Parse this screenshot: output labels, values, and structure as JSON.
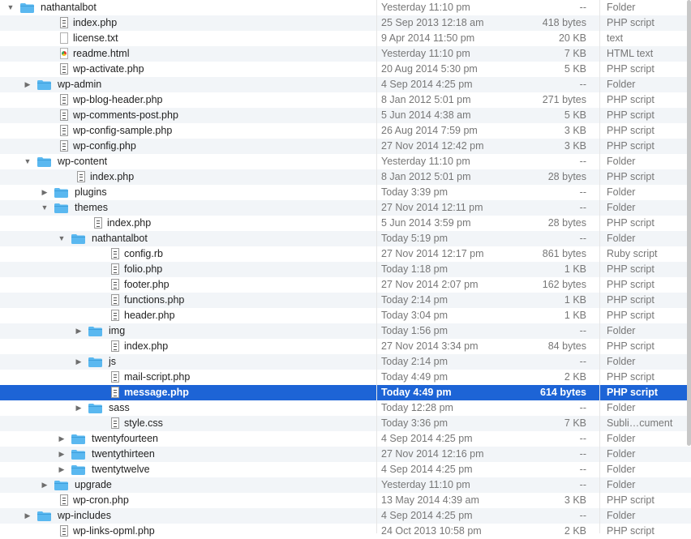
{
  "colors": {
    "selection": "#1d64d6",
    "folder": "#5ab8f0"
  },
  "rows": [
    {
      "depth": 0,
      "icon": "folder",
      "expanded": true,
      "name": "nathantalbot",
      "date": "Yesterday 11:10 pm",
      "size": "--",
      "kind": "Folder"
    },
    {
      "depth": 1,
      "icon": "doc",
      "name": "index.php",
      "date": "25 Sep 2013 12:18 am",
      "size": "418 bytes",
      "kind": "PHP script"
    },
    {
      "depth": 1,
      "icon": "txt",
      "name": "license.txt",
      "date": "9 Apr 2014 11:50 pm",
      "size": "20 KB",
      "kind": "text"
    },
    {
      "depth": 1,
      "icon": "html",
      "name": "readme.html",
      "date": "Yesterday 11:10 pm",
      "size": "7 KB",
      "kind": "HTML text"
    },
    {
      "depth": 1,
      "icon": "doc",
      "name": "wp-activate.php",
      "date": "20 Aug 2014 5:30 pm",
      "size": "5 KB",
      "kind": "PHP script"
    },
    {
      "depth": 1,
      "icon": "folder",
      "expanded": false,
      "name": "wp-admin",
      "date": "4 Sep 2014 4:25 pm",
      "size": "--",
      "kind": "Folder"
    },
    {
      "depth": 1,
      "icon": "doc",
      "name": "wp-blog-header.php",
      "date": "8 Jan 2012 5:01 pm",
      "size": "271 bytes",
      "kind": "PHP script"
    },
    {
      "depth": 1,
      "icon": "doc",
      "name": "wp-comments-post.php",
      "date": "5 Jun 2014 4:38 am",
      "size": "5 KB",
      "kind": "PHP script"
    },
    {
      "depth": 1,
      "icon": "doc",
      "name": "wp-config-sample.php",
      "date": "26 Aug 2014 7:59 pm",
      "size": "3 KB",
      "kind": "PHP script"
    },
    {
      "depth": 1,
      "icon": "doc",
      "name": "wp-config.php",
      "date": "27 Nov 2014 12:42 pm",
      "size": "3 KB",
      "kind": "PHP script"
    },
    {
      "depth": 1,
      "icon": "folder",
      "expanded": true,
      "name": "wp-content",
      "date": "Yesterday 11:10 pm",
      "size": "--",
      "kind": "Folder"
    },
    {
      "depth": 2,
      "icon": "doc",
      "name": "index.php",
      "date": "8 Jan 2012 5:01 pm",
      "size": "28 bytes",
      "kind": "PHP script"
    },
    {
      "depth": 2,
      "icon": "folder",
      "expanded": false,
      "name": "plugins",
      "date": "Today 3:39 pm",
      "size": "--",
      "kind": "Folder"
    },
    {
      "depth": 2,
      "icon": "folder",
      "expanded": true,
      "name": "themes",
      "date": "27 Nov 2014 12:11 pm",
      "size": "--",
      "kind": "Folder"
    },
    {
      "depth": 3,
      "icon": "doc",
      "name": "index.php",
      "date": "5 Jun 2014 3:59 pm",
      "size": "28 bytes",
      "kind": "PHP script"
    },
    {
      "depth": 3,
      "icon": "folder",
      "expanded": true,
      "name": "nathantalbot",
      "date": "Today 5:19 pm",
      "size": "--",
      "kind": "Folder"
    },
    {
      "depth": 4,
      "icon": "doc",
      "name": "config.rb",
      "date": "27 Nov 2014 12:17 pm",
      "size": "861 bytes",
      "kind": "Ruby script"
    },
    {
      "depth": 4,
      "icon": "doc",
      "name": "folio.php",
      "date": "Today 1:18 pm",
      "size": "1 KB",
      "kind": "PHP script"
    },
    {
      "depth": 4,
      "icon": "doc",
      "name": "footer.php",
      "date": "27 Nov 2014 2:07 pm",
      "size": "162 bytes",
      "kind": "PHP script"
    },
    {
      "depth": 4,
      "icon": "doc",
      "name": "functions.php",
      "date": "Today 2:14 pm",
      "size": "1 KB",
      "kind": "PHP script"
    },
    {
      "depth": 4,
      "icon": "doc",
      "name": "header.php",
      "date": "Today 3:04 pm",
      "size": "1 KB",
      "kind": "PHP script"
    },
    {
      "depth": 4,
      "icon": "folder",
      "expanded": false,
      "name": "img",
      "date": "Today 1:56 pm",
      "size": "--",
      "kind": "Folder"
    },
    {
      "depth": 4,
      "icon": "doc",
      "name": "index.php",
      "date": "27 Nov 2014 3:34 pm",
      "size": "84 bytes",
      "kind": "PHP script"
    },
    {
      "depth": 4,
      "icon": "folder",
      "expanded": false,
      "name": "js",
      "date": "Today 2:14 pm",
      "size": "--",
      "kind": "Folder"
    },
    {
      "depth": 4,
      "icon": "doc",
      "name": "mail-script.php",
      "date": "Today 4:49 pm",
      "size": "2 KB",
      "kind": "PHP script"
    },
    {
      "depth": 4,
      "icon": "doc",
      "selected": true,
      "name": "message.php",
      "date": "Today 4:49 pm",
      "size": "614 bytes",
      "kind": "PHP script"
    },
    {
      "depth": 4,
      "icon": "folder",
      "expanded": false,
      "name": "sass",
      "date": "Today 12:28 pm",
      "size": "--",
      "kind": "Folder"
    },
    {
      "depth": 4,
      "icon": "doc",
      "name": "style.css",
      "date": "Today 3:36 pm",
      "size": "7 KB",
      "kind": "Subli…cument"
    },
    {
      "depth": 3,
      "icon": "folder",
      "expanded": false,
      "name": "twentyfourteen",
      "date": "4 Sep 2014 4:25 pm",
      "size": "--",
      "kind": "Folder"
    },
    {
      "depth": 3,
      "icon": "folder",
      "expanded": false,
      "name": "twentythirteen",
      "date": "27 Nov 2014 12:16 pm",
      "size": "--",
      "kind": "Folder"
    },
    {
      "depth": 3,
      "icon": "folder",
      "expanded": false,
      "name": "twentytwelve",
      "date": "4 Sep 2014 4:25 pm",
      "size": "--",
      "kind": "Folder"
    },
    {
      "depth": 2,
      "icon": "folder",
      "expanded": false,
      "name": "upgrade",
      "date": "Yesterday 11:10 pm",
      "size": "--",
      "kind": "Folder"
    },
    {
      "depth": 1,
      "icon": "doc",
      "name": "wp-cron.php",
      "date": "13 May 2014 4:39 am",
      "size": "3 KB",
      "kind": "PHP script"
    },
    {
      "depth": 1,
      "icon": "folder",
      "expanded": false,
      "name": "wp-includes",
      "date": "4 Sep 2014 4:25 pm",
      "size": "--",
      "kind": "Folder"
    },
    {
      "depth": 1,
      "icon": "doc",
      "name": "wp-links-opml.php",
      "date": "24 Oct 2013 10:58 pm",
      "size": "2 KB",
      "kind": "PHP script"
    }
  ]
}
